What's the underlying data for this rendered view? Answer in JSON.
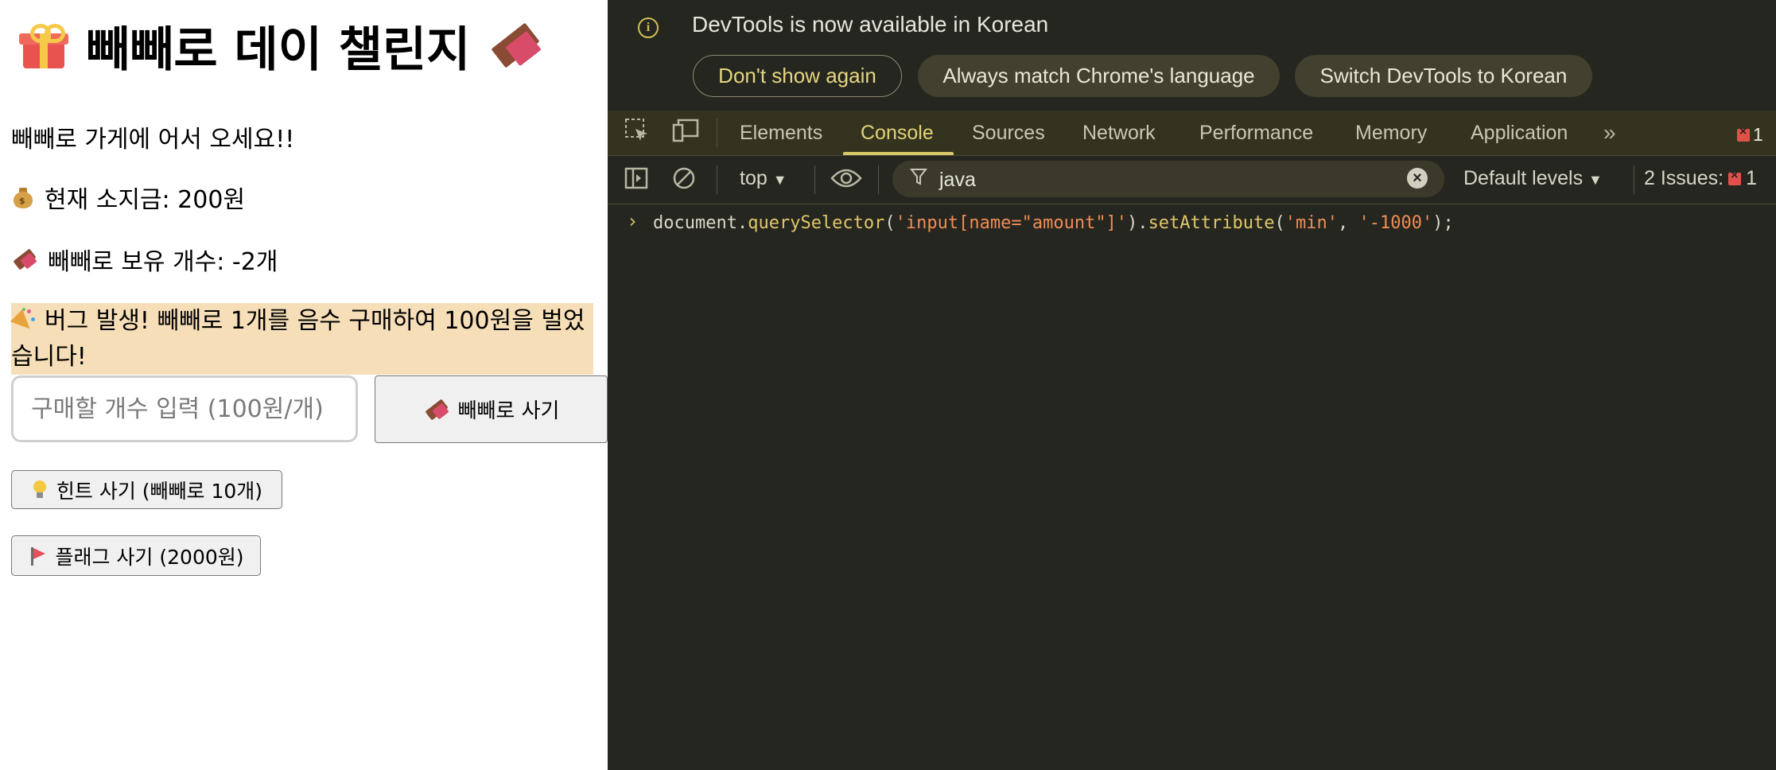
{
  "page": {
    "title": "빼빼로 데이 챌린지",
    "title_icon_left": "gift-icon",
    "title_icon_right": "chocolate-icon",
    "welcome": "빼빼로 가게에 어서 오세요!!",
    "balance": "현재 소지금: 200원",
    "balance_icon": "money-bag-icon",
    "owned": "빼빼로 보유 개수: -2개",
    "owned_icon": "chocolate-icon",
    "alert": "버그 발생! 빼빼로 1개를 음수 구매하여 100원을 벌었습니다!",
    "alert_icon": "party-popper-icon",
    "alert_bg": "#f6dfb8",
    "amount_placeholder": "구매할 개수 입력 (100원/개)",
    "amount_value": "",
    "buy_label": "빼빼로 사기",
    "hint_label": "힌트 사기 (빼빼로 10개)",
    "flag_label": "플래그 사기 (2000원)"
  },
  "devtools": {
    "infobar": {
      "text": "DevTools is now available in Korean",
      "dont_show": "Don't show again",
      "always_match": "Always match Chrome's language",
      "switch": "Switch DevTools to Korean"
    },
    "tabs": [
      "Elements",
      "Console",
      "Sources",
      "Network",
      "Performance",
      "Memory",
      "Application"
    ],
    "active_tab": "Console",
    "error_count": "1",
    "toolbar": {
      "context": "top",
      "filter": "java",
      "levels": "Default levels",
      "issues_label": "2 Issues:",
      "issues_count": "1"
    },
    "console": {
      "prompt": "›",
      "code_prefix": "document.",
      "code_fn1": "querySelector",
      "code_arg1": "'input[name=\"amount\"]'",
      "code_fn2": "setAttribute",
      "code_arg2": "'min'",
      "code_arg3": "'-1000'"
    },
    "accent": "#d7c867"
  }
}
